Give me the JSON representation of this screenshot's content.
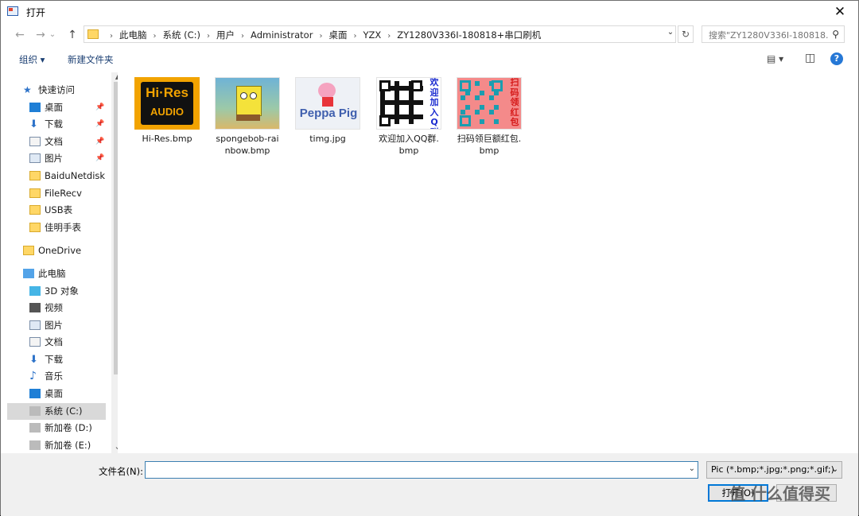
{
  "window": {
    "title": "打开",
    "close_glyph": "✕"
  },
  "nav": {
    "back_glyph": "←",
    "forward_glyph": "→",
    "history_glyph": "⌄",
    "up_glyph": "↑",
    "breadcrumbs": [
      "此电脑",
      "系统 (C:)",
      "用户",
      "Administrator",
      "桌面",
      "YZX",
      "ZY1280V336I-180818+串口刷机"
    ],
    "search_placeholder": "搜索\"ZY1280V336I-180818...",
    "refresh_glyph": "↻",
    "search_icon": "⚲"
  },
  "toolbar": {
    "organize": "组织 ▾",
    "new_folder": "新建文件夹",
    "view_glyph": "▤ ▾",
    "pane_glyph": "◫",
    "help": "?"
  },
  "sidebar": {
    "items": [
      {
        "label": "快速访问",
        "icon": "star-icon",
        "indent": false,
        "pin": false
      },
      {
        "label": "桌面",
        "icon": "desktop-icon",
        "indent": true,
        "pin": true
      },
      {
        "label": "下载",
        "icon": "download-icon",
        "indent": true,
        "pin": true
      },
      {
        "label": "文档",
        "icon": "document-icon",
        "indent": true,
        "pin": true
      },
      {
        "label": "图片",
        "icon": "picture-icon",
        "indent": true,
        "pin": true
      },
      {
        "label": "BaiduNetdiskD",
        "icon": "folder-icon",
        "indent": true,
        "pin": false
      },
      {
        "label": "FileRecv",
        "icon": "folder-icon",
        "indent": true,
        "pin": false
      },
      {
        "label": "USB表",
        "icon": "folder-icon",
        "indent": true,
        "pin": false
      },
      {
        "label": "佳明手表",
        "icon": "folder-icon",
        "indent": true,
        "pin": false
      },
      {
        "label": "OneDrive",
        "icon": "folder-icon",
        "indent": false,
        "pin": false
      },
      {
        "label": "此电脑",
        "icon": "computer-icon",
        "indent": false,
        "pin": false
      },
      {
        "label": "3D 对象",
        "icon": "cube-icon",
        "indent": true,
        "pin": false
      },
      {
        "label": "视频",
        "icon": "video-icon",
        "indent": true,
        "pin": false
      },
      {
        "label": "图片",
        "icon": "picture-icon",
        "indent": true,
        "pin": false
      },
      {
        "label": "文档",
        "icon": "document-icon",
        "indent": true,
        "pin": false
      },
      {
        "label": "下载",
        "icon": "download-icon",
        "indent": true,
        "pin": false
      },
      {
        "label": "音乐",
        "icon": "music-icon",
        "indent": true,
        "pin": false
      },
      {
        "label": "桌面",
        "icon": "desktop-icon",
        "indent": true,
        "pin": false
      },
      {
        "label": "系统 (C:)",
        "icon": "drive-icon",
        "indent": true,
        "pin": false,
        "selected": true
      },
      {
        "label": "新加卷 (D:)",
        "icon": "drive-icon",
        "indent": true,
        "pin": false
      },
      {
        "label": "新加卷 (E:)",
        "icon": "drive-icon",
        "indent": true,
        "pin": false
      }
    ],
    "pin_glyph": "📌",
    "scroll_up": "▲",
    "scroll_down": "⌄"
  },
  "files": [
    {
      "name": "Hi-Res.bmp",
      "thumb": "hires",
      "line1": "Hi-Res.bmp",
      "line2": "",
      "thumb_text_1": "Hi·Res",
      "thumb_text_2": "AUDIO"
    },
    {
      "name": "spongebob-rainbow.bmp",
      "thumb": "sponge",
      "line1": "spongebob-rai",
      "line2": "nbow.bmp"
    },
    {
      "name": "timg.jpg",
      "thumb": "peppa",
      "line1": "timg.jpg",
      "line2": "",
      "thumb_text_1": "Peppa Pig"
    },
    {
      "name": "欢迎加入QQ群.bmp",
      "thumb": "qr1",
      "line1": "欢迎加入QQ群.",
      "line2": "bmp",
      "thumb_text_1": "欢迎加入Q群"
    },
    {
      "name": "扫码领巨额红包.bmp",
      "thumb": "qr2",
      "line1": "扫码领巨额红包.",
      "line2": "bmp",
      "thumb_text_1": "扫码领红包"
    }
  ],
  "bottom": {
    "filename_label": "文件名(N):",
    "filename_value": "",
    "filetype": "Pic (*.bmp;*.jpg;*.png;*.gif;)",
    "open_label": "打开(O)",
    "dd_glyph": "⌄"
  },
  "watermark": "值 什么值得买"
}
